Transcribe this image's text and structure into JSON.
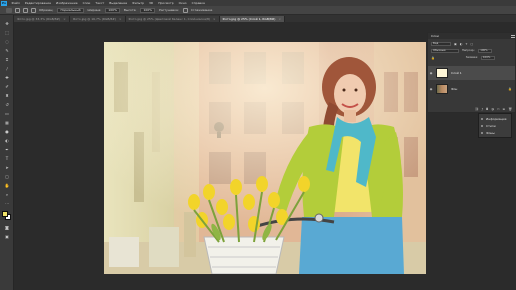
{
  "app": {
    "logo": "Ps",
    "menu": [
      "Файл",
      "Редактирование",
      "Изображение",
      "Слои",
      "Текст",
      "Выделение",
      "Фильтр",
      "3D",
      "Просмотр",
      "Окно",
      "Справка"
    ]
  },
  "options_bar": {
    "items": [
      "Образец:",
      "Нормальный",
      "Ширина:",
      "Высота:",
      "Растушевка:",
      "Сглаживание"
    ],
    "width_value": "100%",
    "height_value": "100%"
  },
  "tabs": [
    {
      "label": "Фото.jpg @ 33,3% (RGB/8#)",
      "active": false
    },
    {
      "label": "Фото.jpg @ 16,7% (RGB/8#)",
      "active": false
    },
    {
      "label": "Фото.jpg @ 25% (Цветовой баланс 1, Слой-маска/8)",
      "active": false
    },
    {
      "label": "Фото.jpg @ 25% (Слой 1, RGB/8#)",
      "active": true
    }
  ],
  "tools": [
    "move-icon",
    "marquee-icon",
    "lasso-icon",
    "quick-select-icon",
    "crop-icon",
    "eyedropper-icon",
    "healing-icon",
    "brush-icon",
    "stamp-icon",
    "history-brush-icon",
    "eraser-icon",
    "gradient-icon",
    "blur-icon",
    "dodge-icon",
    "pen-icon",
    "type-icon",
    "path-select-icon",
    "rectangle-icon",
    "hand-icon",
    "zoom-icon"
  ],
  "colors": {
    "foreground": "#f2e46a",
    "background": "#ffffff",
    "ps_blue": "#2aa3e9"
  },
  "layers_panel": {
    "title": "Слои",
    "filter_label": "Вид",
    "blend_mode": "Обычные",
    "opacity_label": "Непрозр.:",
    "opacity_value": "100%",
    "fill_label": "Заливка:",
    "fill_value": "100%",
    "layers": [
      {
        "name": "Слой 1",
        "selected": true
      },
      {
        "name": "Фон",
        "selected": false
      }
    ]
  },
  "popup_menu": {
    "items": [
      "Информация",
      "Стили",
      "Фоны"
    ]
  }
}
